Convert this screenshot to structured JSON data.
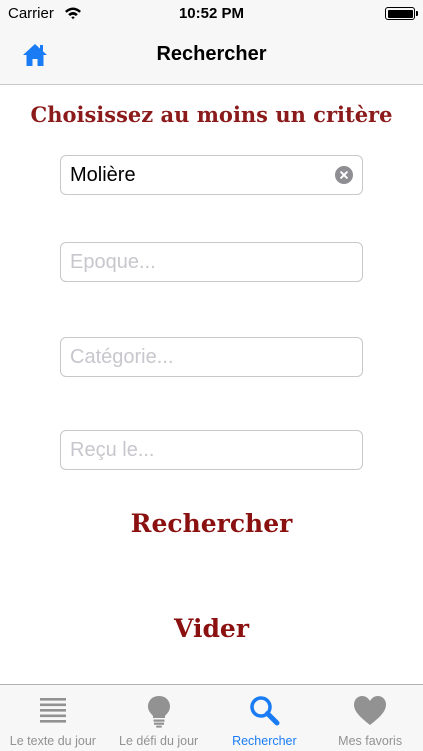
{
  "status_bar": {
    "carrier": "Carrier",
    "time": "10:52 PM"
  },
  "nav": {
    "title": "Rechercher",
    "home_icon": "home-icon"
  },
  "heading": "Choisissez au moins un critère",
  "fields": {
    "author": {
      "value": "Molière",
      "placeholder": ""
    },
    "epoch": {
      "value": "",
      "placeholder": "Epoque..."
    },
    "category": {
      "value": "",
      "placeholder": "Catégorie..."
    },
    "received": {
      "value": "",
      "placeholder": "Reçu le..."
    }
  },
  "buttons": {
    "search": "Rechercher",
    "clear": "Vider"
  },
  "tabs": [
    {
      "label": "Le texte du jour",
      "icon": "lines-icon"
    },
    {
      "label": "Le défi du jour",
      "icon": "lightbulb-icon"
    },
    {
      "label": "Rechercher",
      "icon": "search-icon",
      "active": true
    },
    {
      "label": "Mes favoris",
      "icon": "heart-icon"
    }
  ],
  "colors": {
    "accent": "#1a7cf5",
    "brand": "#8b1a1a",
    "inactive": "#929292"
  }
}
